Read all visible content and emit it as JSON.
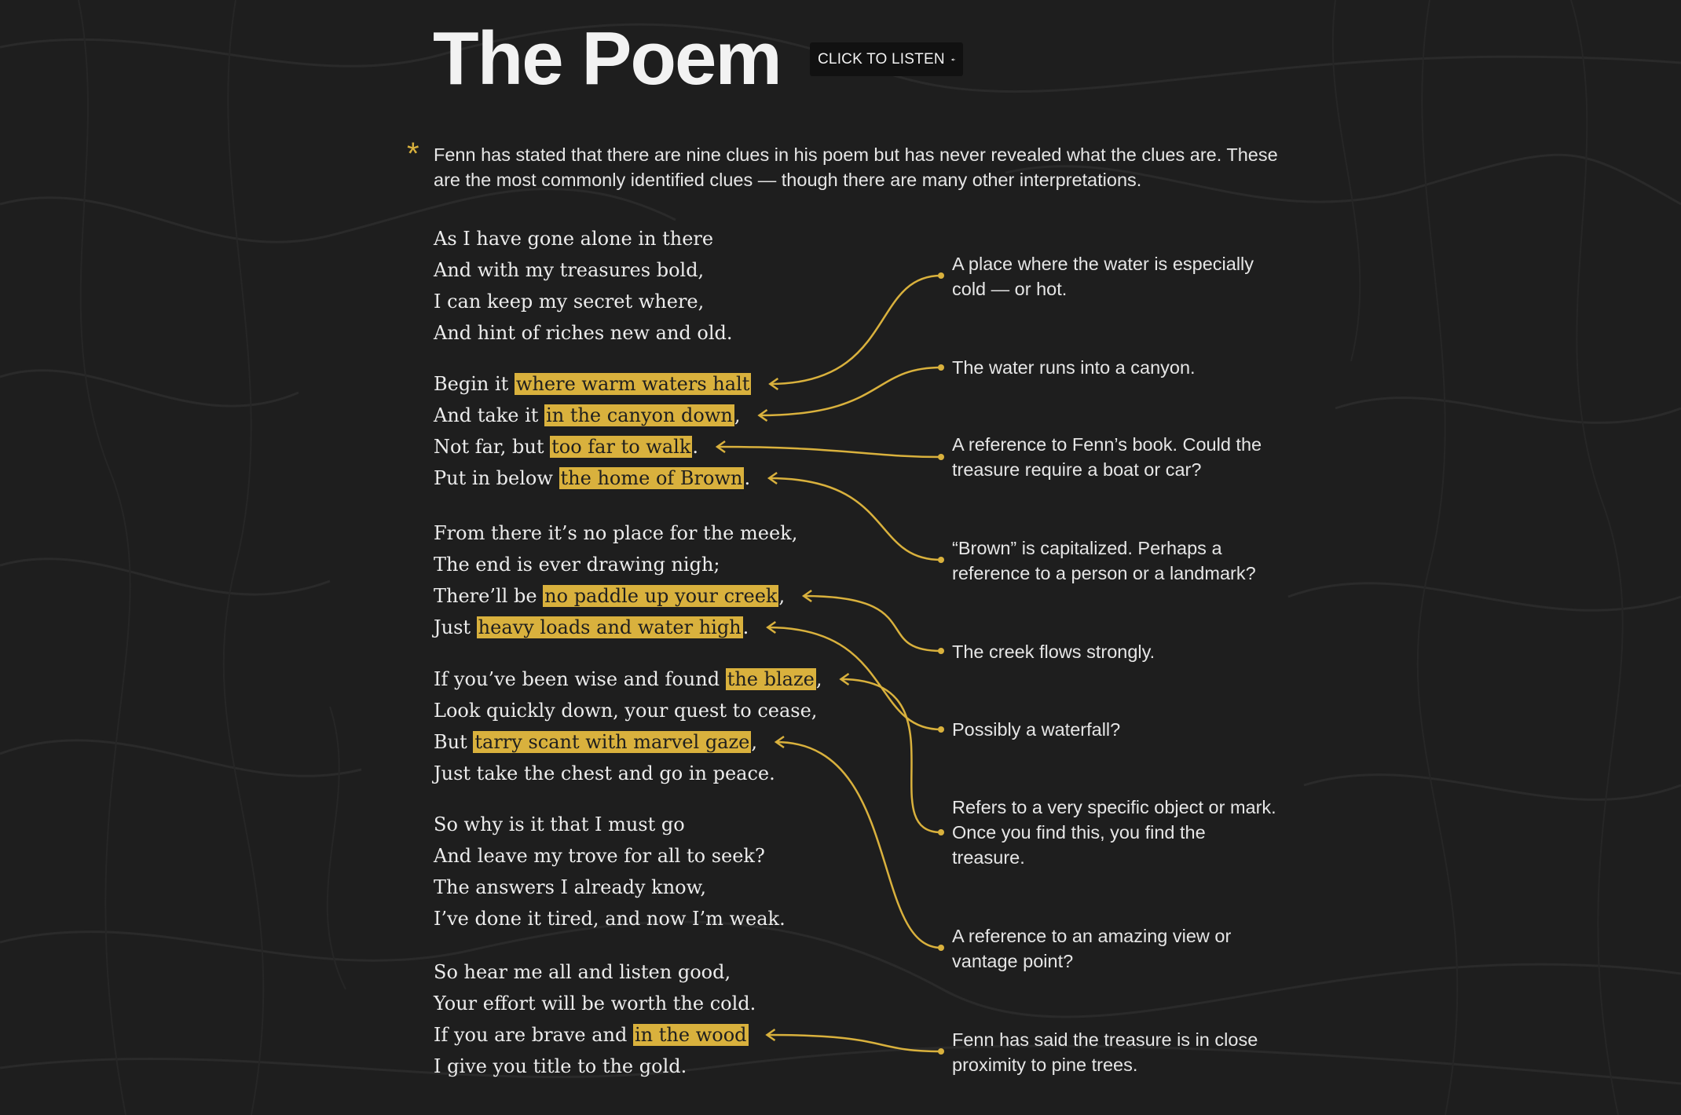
{
  "header": {
    "title": "The Poem",
    "listen_label": "CLICK TO LISTEN",
    "listen_icon": "speaker-muted-icon"
  },
  "intro": {
    "marker": "*",
    "text": "Fenn has stated that there are nine clues in his poem but has never revealed what the clues are. These are the most commonly identified clues — though there are many other interpretations."
  },
  "poem": {
    "stanzas": [
      [
        {
          "pre": "As I have gone alone in there",
          "clue": "",
          "post": ""
        },
        {
          "pre": "And with my treasures bold,",
          "clue": "",
          "post": ""
        },
        {
          "pre": "I can keep my secret where,",
          "clue": "",
          "post": ""
        },
        {
          "pre": "And hint of riches new and old.",
          "clue": "",
          "post": ""
        }
      ],
      [
        {
          "pre": "Begin it ",
          "clue": "where warm waters halt",
          "post": ""
        },
        {
          "pre": "And take it ",
          "clue": "in the canyon down",
          "post": ","
        },
        {
          "pre": "Not far, but ",
          "clue": "too far to walk",
          "post": "."
        },
        {
          "pre": "Put in below ",
          "clue": "the home of Brown",
          "post": "."
        }
      ],
      [
        {
          "pre": "From there it’s no place for the meek,",
          "clue": "",
          "post": ""
        },
        {
          "pre": "The end is ever drawing nigh;",
          "clue": "",
          "post": ""
        },
        {
          "pre": "There’ll be ",
          "clue": "no paddle up your creek",
          "post": ","
        },
        {
          "pre": "Just ",
          "clue": "heavy loads and water high",
          "post": "."
        }
      ],
      [
        {
          "pre": "If you’ve been wise and found ",
          "clue": "the blaze",
          "post": ","
        },
        {
          "pre": "Look quickly down, your quest to cease,",
          "clue": "",
          "post": ""
        },
        {
          "pre": "But ",
          "clue": "tarry scant with marvel gaze",
          "post": ","
        },
        {
          "pre": "Just take the chest and go in peace.",
          "clue": "",
          "post": ""
        }
      ],
      [
        {
          "pre": "So why is it that I must go",
          "clue": "",
          "post": ""
        },
        {
          "pre": "And leave my trove for all to seek?",
          "clue": "",
          "post": ""
        },
        {
          "pre": "The answers I already know,",
          "clue": "",
          "post": ""
        },
        {
          "pre": "I’ve done it tired, and now I’m weak.",
          "clue": "",
          "post": ""
        }
      ],
      [
        {
          "pre": "So hear me all and listen good,",
          "clue": "",
          "post": ""
        },
        {
          "pre": "Your effort will be worth the cold.",
          "clue": "",
          "post": ""
        },
        {
          "pre": "If you are brave and ",
          "clue": "in the wood",
          "post": ""
        },
        {
          "pre": "I give you title to the gold.",
          "clue": "",
          "post": ""
        }
      ]
    ]
  },
  "notes": [
    "A place where the water is especially cold — or hot.",
    "The water runs into a canyon.",
    "A reference to Fenn’s book. Could the treasure require a boat or car?",
    "“Brown” is capitalized. Perhaps a reference to a person or a landmark?",
    "The creek flows strongly.",
    "Possibly a waterfall?",
    "Refers to a very specific object or mark. Once you find this, you find the treasure.",
    "A reference to an amazing view or vantage point?",
    "Fenn has said the treasure is in close proximity to pine trees."
  ],
  "colors": {
    "background": "#1e1e1e",
    "highlight": "#d9b13d",
    "text": "#ececec",
    "connector": "#d9b13d"
  }
}
